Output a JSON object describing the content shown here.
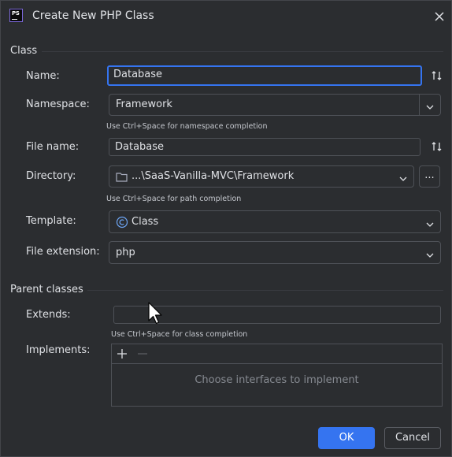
{
  "window": {
    "title": "Create New PHP Class",
    "logo_text": "PS",
    "icons": {
      "logo": "phpstorm-logo-icon",
      "close": "close-icon"
    }
  },
  "class_section": {
    "heading": "Class",
    "name": {
      "label": "Name:",
      "value": "Database"
    },
    "namespace": {
      "label": "Namespace:",
      "value": "Framework",
      "hint": "Use Ctrl+Space for namespace completion"
    },
    "file_name": {
      "label": "File name:",
      "value": "Database"
    },
    "directory": {
      "label": "Directory:",
      "value": "...\\SaaS-Vanilla-MVC\\Framework",
      "hint": "Use Ctrl+Space for path completion",
      "browse_label": "..."
    },
    "template": {
      "label": "Template:",
      "value": "Class"
    },
    "file_extension": {
      "label": "File extension:",
      "value": "php"
    }
  },
  "parent_section": {
    "heading": "Parent classes",
    "extends": {
      "label": "Extends:",
      "value": "",
      "hint": "Use Ctrl+Space for class completion"
    },
    "implements": {
      "label": "Implements:",
      "empty_text": "Choose interfaces to implement"
    }
  },
  "buttons": {
    "ok": "OK",
    "cancel": "Cancel"
  },
  "colors": {
    "accent": "#3574f0",
    "background": "#2b2d30",
    "border": "#4e5157",
    "text": "#dfe1e5",
    "muted": "#868a91"
  }
}
